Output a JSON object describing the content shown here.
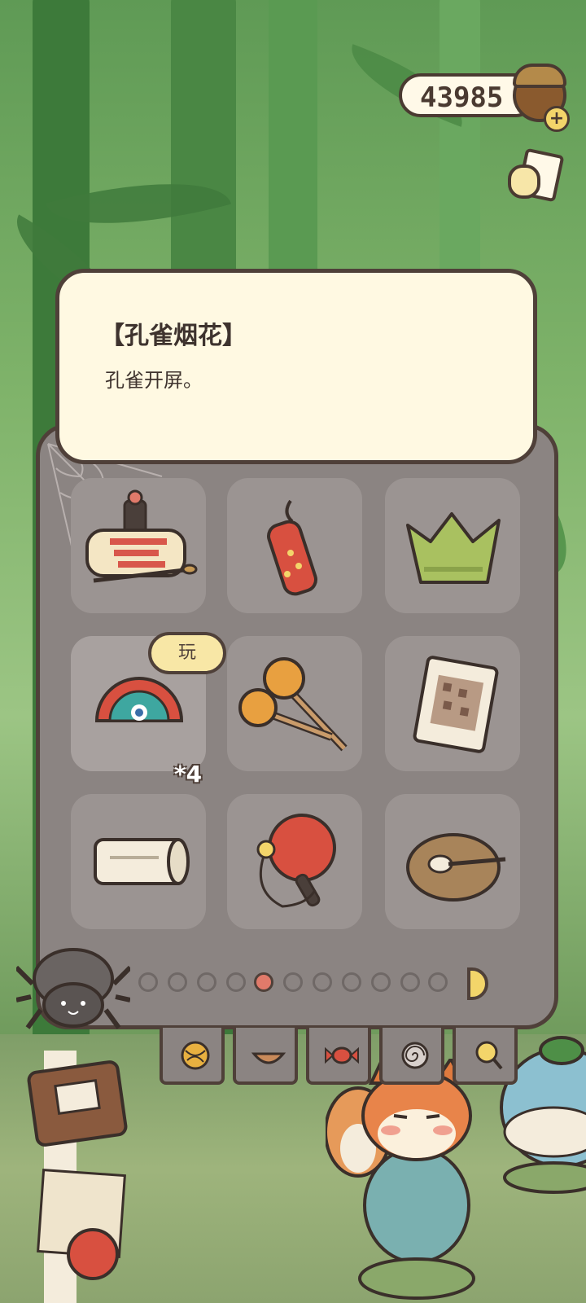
{
  "currency": {
    "amount": "43985",
    "add_symbol": "+"
  },
  "item_detail": {
    "title": "【孔雀烟花】",
    "description": "孔雀开屏。"
  },
  "inventory": {
    "slots": [
      {
        "item": "scroll-brush-set-icon"
      },
      {
        "item": "firecracker-icon"
      },
      {
        "item": "leaf-crown-icon"
      },
      {
        "item": "peacock-firework-icon",
        "selected": true
      },
      {
        "item": "maracas-icon"
      },
      {
        "item": "picture-book-icon"
      },
      {
        "item": "paper-roll-icon"
      },
      {
        "item": "ping-pong-paddle-icon"
      },
      {
        "item": "clay-pot-icon"
      }
    ],
    "selected_count": "*4",
    "play_label": "玩",
    "pages_total": 11,
    "current_page": 5
  },
  "tabs": [
    {
      "icon": "yarn-ball-icon"
    },
    {
      "icon": "bowl-icon"
    },
    {
      "icon": "candy-icon"
    },
    {
      "icon": "snail-shell-icon"
    },
    {
      "icon": "magnifier-icon"
    }
  ],
  "colors": {
    "panel": "#8b8482",
    "card": "#fff9e2",
    "outline": "#4f4039",
    "accent": "#f3d56a",
    "active_dot": "#e07a6a"
  }
}
